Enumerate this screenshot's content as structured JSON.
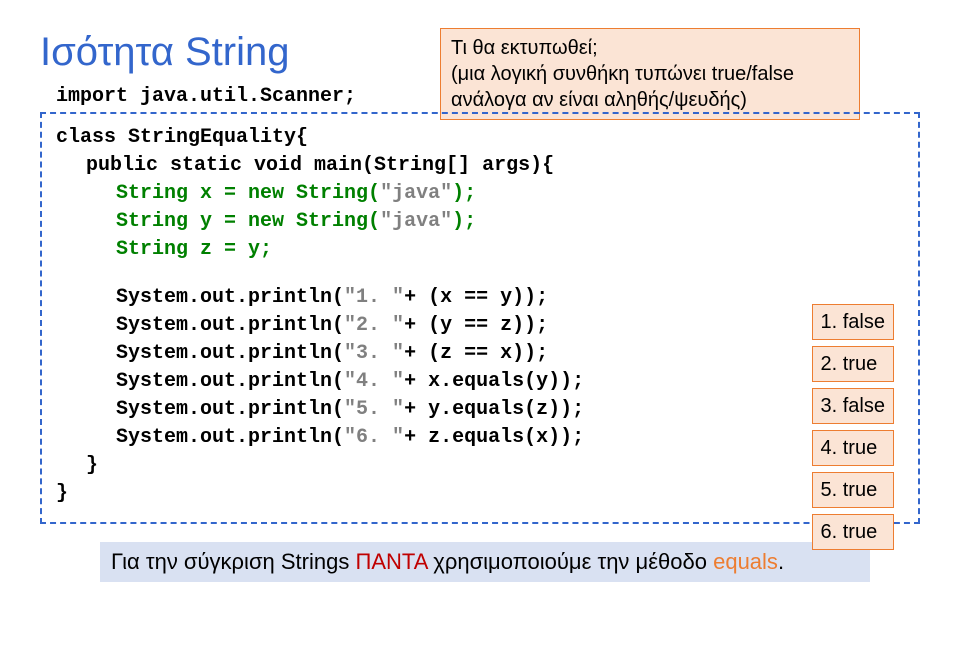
{
  "title": "Ισότητα String",
  "import_line": "import java.util.Scanner;",
  "callout": {
    "line1": "Τι θα εκτυπωθεί;",
    "line2": "(μια λογική συνθήκη τυπώνει true/false ανάλογα αν είναι αληθής/ψευδής)"
  },
  "code": {
    "l1": "class StringEquality{",
    "l2a": "public static void main(String[] args){",
    "l3a": "String x = ",
    "l3b": "new",
    "l3c": " String(",
    "l3d": "\"java\"",
    "l3e": ");",
    "l4a": "String y = ",
    "l4b": "new",
    "l4c": " String(",
    "l4d": "\"java\"",
    "l4e": ");",
    "l5": "String z = y;",
    "p1a": "System.out.println(",
    "p1b": "\"1. \"",
    "p1c": "+ (x == y));",
    "p2a": "System.out.println(",
    "p2b": "\"2. \"",
    "p2c": "+ (y == z));",
    "p3a": "System.out.println(",
    "p3b": "\"3. \"",
    "p3c": "+ (z == x));",
    "p4a": "System.out.println(",
    "p4b": "\"4. \"",
    "p4c": "+ x.equals(y));",
    "p5a": "System.out.println(",
    "p5b": "\"5. \"",
    "p5c": "+ y.equals(z));",
    "p6a": "System.out.println(",
    "p6b": "\"6. \"",
    "p6c": "+ z.equals(x));",
    "close1": "}",
    "close2": "}"
  },
  "answers": [
    "1. false",
    "2. true",
    "3. false",
    "4. true",
    "5. true",
    "6. true"
  ],
  "footer": {
    "t1": "Για την σύγκριση Strings ",
    "t2": "ΠΑΝΤΑ",
    "t3": " χρησιμοποιούμε την μέθοδο ",
    "t4": "equals",
    "t5": "."
  }
}
